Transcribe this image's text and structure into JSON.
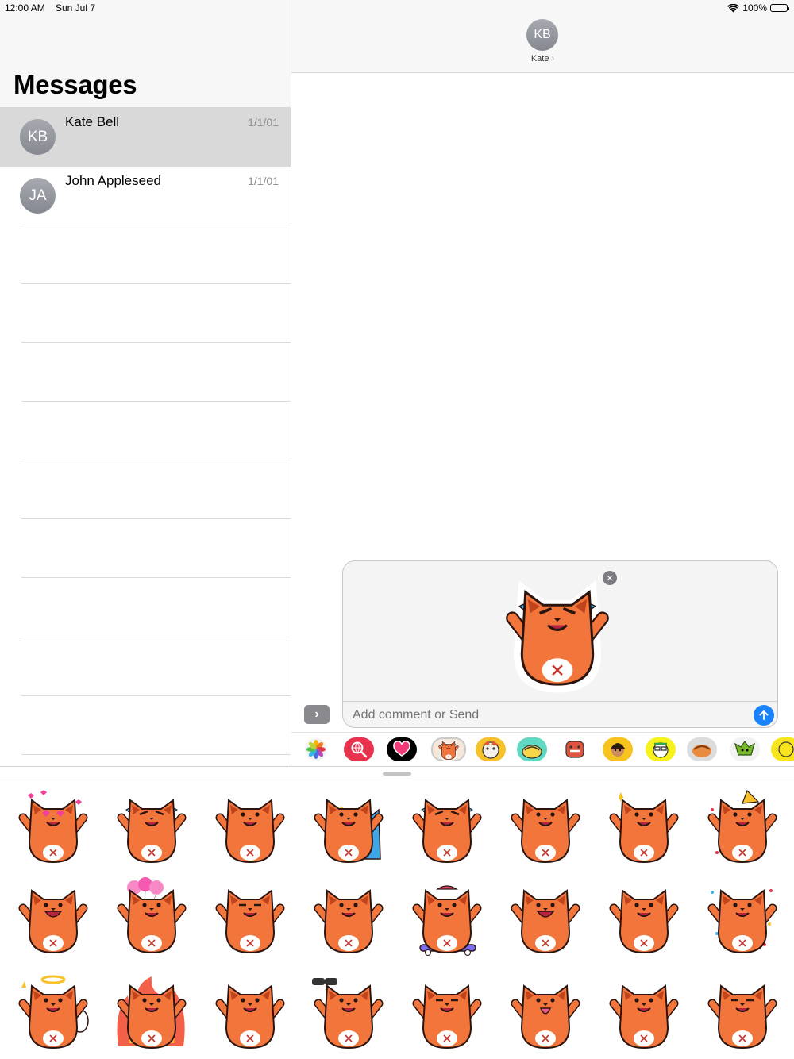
{
  "status_bar": {
    "time": "12:00 AM",
    "date": "Sun Jul 7",
    "battery": "100%"
  },
  "sidebar": {
    "title": "Messages",
    "conversations": [
      {
        "initials": "KB",
        "name": "Kate Bell",
        "date": "1/1/01",
        "selected": true
      },
      {
        "initials": "JA",
        "name": "John Appleseed",
        "date": "1/1/01",
        "selected": false
      }
    ]
  },
  "conversation": {
    "contact_initials": "KB",
    "contact_name": "Kate"
  },
  "compose": {
    "placeholder": "Add comment or Send",
    "staged_sticker": "fox-crying-sticker"
  },
  "app_drawer": {
    "apps": [
      "photos-app",
      "search-images-app",
      "digital-touch-app",
      "fox-stickers-app",
      "sticker-app-2",
      "sticker-app-3",
      "sticker-app-4",
      "sticker-app-5",
      "sticker-app-6",
      "sticker-app-7",
      "sticker-app-8",
      "sticker-app-9"
    ]
  },
  "stickers": [
    {
      "name": "fox-heart-eyes-sticker",
      "pose": "love"
    },
    {
      "name": "fox-crying-lying-sticker",
      "pose": "cry"
    },
    {
      "name": "fox-jumping-sticker",
      "pose": "jump"
    },
    {
      "name": "fox-injured-sticker",
      "pose": "hurt"
    },
    {
      "name": "fox-crying-sticker",
      "pose": "cry"
    },
    {
      "name": "fox-dancing-sticker",
      "pose": "dance"
    },
    {
      "name": "fox-eating-sticker",
      "pose": "eat"
    },
    {
      "name": "fox-party-sticker",
      "pose": "party"
    },
    {
      "name": "fox-laughing-sticker",
      "pose": "laugh"
    },
    {
      "name": "fox-balloons-sticker",
      "pose": "balloon"
    },
    {
      "name": "fox-facepalm-sticker",
      "pose": "palm"
    },
    {
      "name": "fox-donut-sticker",
      "pose": "donut"
    },
    {
      "name": "fox-skateboard-sticker",
      "pose": "skate"
    },
    {
      "name": "fox-cheering-sticker",
      "pose": "cheer"
    },
    {
      "name": "fox-box-sticker",
      "pose": "box"
    },
    {
      "name": "fox-confetti-sticker",
      "pose": "confetti"
    },
    {
      "name": "fox-angel-music-sticker",
      "pose": "angel"
    },
    {
      "name": "fox-angry-fire-sticker",
      "pose": "fire"
    },
    {
      "name": "fox-turned-away-sticker",
      "pose": "back"
    },
    {
      "name": "fox-binoculars-sticker",
      "pose": "binoc"
    },
    {
      "name": "fox-thinking-sticker",
      "pose": "think"
    },
    {
      "name": "fox-tongue-sticker",
      "pose": "tongue"
    },
    {
      "name": "fox-walking-sticker",
      "pose": "walk"
    },
    {
      "name": "fox-salute-sticker",
      "pose": "salute"
    }
  ],
  "colors": {
    "fox": "#f2763c",
    "fox_dark": "#c0431b",
    "outline": "#2a1410",
    "accent_blue": "#1a82fb"
  }
}
